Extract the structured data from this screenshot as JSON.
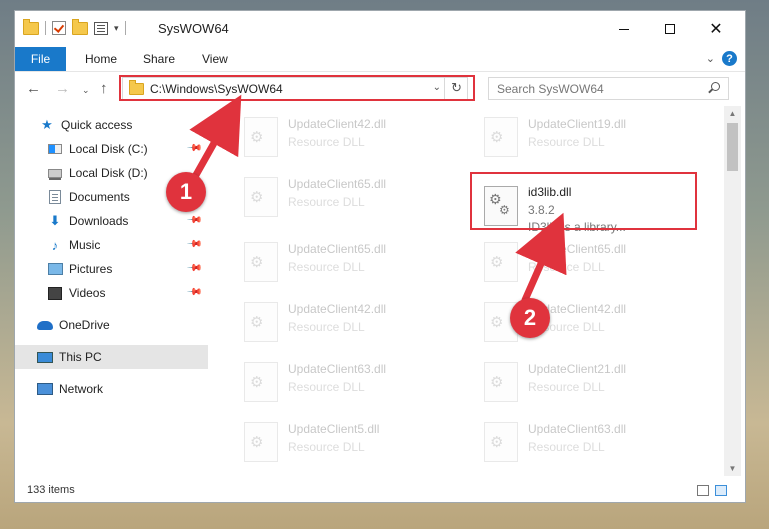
{
  "window": {
    "title": "SysWOW64"
  },
  "ribbon": {
    "tabs": [
      "File",
      "Home",
      "Share",
      "View"
    ],
    "help_label": "?"
  },
  "nav": {
    "address": "C:\\Windows\\SysWOW64",
    "search_placeholder": "Search SysWOW64"
  },
  "sidebar": {
    "items": [
      {
        "label": "Quick access"
      },
      {
        "label": "Local Disk (C:)"
      },
      {
        "label": "Local Disk (D:)"
      },
      {
        "label": "Documents"
      },
      {
        "label": "Downloads"
      },
      {
        "label": "Music"
      },
      {
        "label": "Pictures"
      },
      {
        "label": "Videos"
      },
      {
        "label": "OneDrive"
      },
      {
        "label": "This PC"
      },
      {
        "label": "Network"
      }
    ]
  },
  "files": [
    {
      "name": "UpdateClient42.dll",
      "type": "Resource DLL"
    },
    {
      "name": "UpdateClient19.dll",
      "type": "Resource DLL"
    },
    {
      "name": "UpdateClient65.dll",
      "type": "Resource DLL"
    },
    {
      "name": "id3lib.dll",
      "version": "3.8.2",
      "description": "ID3lib is a library..."
    },
    {
      "name": "UpdateClient65.dll",
      "type": "Resource DLL"
    },
    {
      "name": "UpdateClient65.dll",
      "type": "Resource DLL"
    },
    {
      "name": "UpdateClient42.dll",
      "type": "Resource DLL"
    },
    {
      "name": "UpdateClient42.dll",
      "type": "Resource DLL"
    },
    {
      "name": "UpdateClient63.dll",
      "type": "Resource DLL"
    },
    {
      "name": "UpdateClient21.dll",
      "type": "Resource DLL"
    },
    {
      "name": "UpdateClient5.dll",
      "type": "Resource DLL"
    },
    {
      "name": "UpdateClient63.dll",
      "type": "Resource DLL"
    }
  ],
  "status": {
    "item_count": "133 items"
  },
  "annotations": {
    "step1": "1",
    "step2": "2",
    "color": "#e0333d"
  }
}
